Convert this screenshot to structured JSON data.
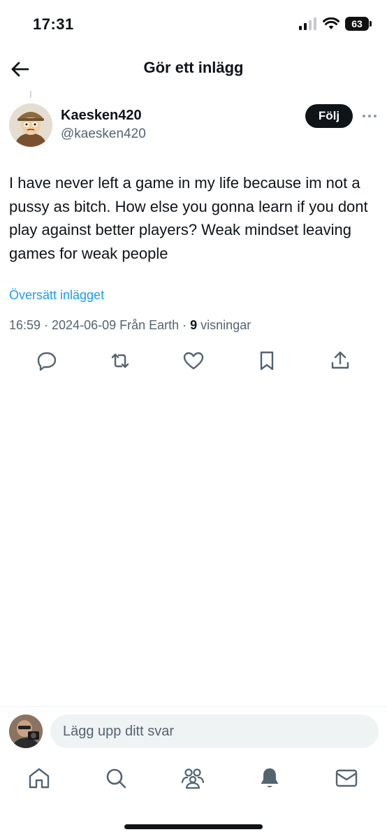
{
  "status_bar": {
    "time": "17:31",
    "battery": "63"
  },
  "header": {
    "title": "Gör ett inlägg"
  },
  "post": {
    "author_name": "Kaesken420",
    "author_handle": "@kaesken420",
    "follow_label": "Följ",
    "text": "I have never left a game in my life because im not a pussy as bitch. How else you gonna learn if you dont play against better players? Weak mindset leaving games for weak people",
    "translate_label": "Översätt inlägget",
    "meta_prefix": "16:59 · 2024-06-09 Från Earth · ",
    "views_count": "9",
    "views_label": " visningar"
  },
  "reply": {
    "placeholder": "Lägg upp ditt svar"
  },
  "icons": {
    "back": "arrow-left-icon",
    "more": "more-dots-icon",
    "reply": "reply-icon",
    "retweet": "retweet-icon",
    "like": "heart-icon",
    "bookmark": "bookmark-icon",
    "share": "share-icon",
    "home": "home-icon",
    "search": "search-icon",
    "communities": "communities-icon",
    "notifications": "bell-icon",
    "messages": "mail-icon"
  },
  "colors": {
    "accent": "#1d9bf0",
    "text": "#0f1419",
    "muted": "#536471"
  }
}
